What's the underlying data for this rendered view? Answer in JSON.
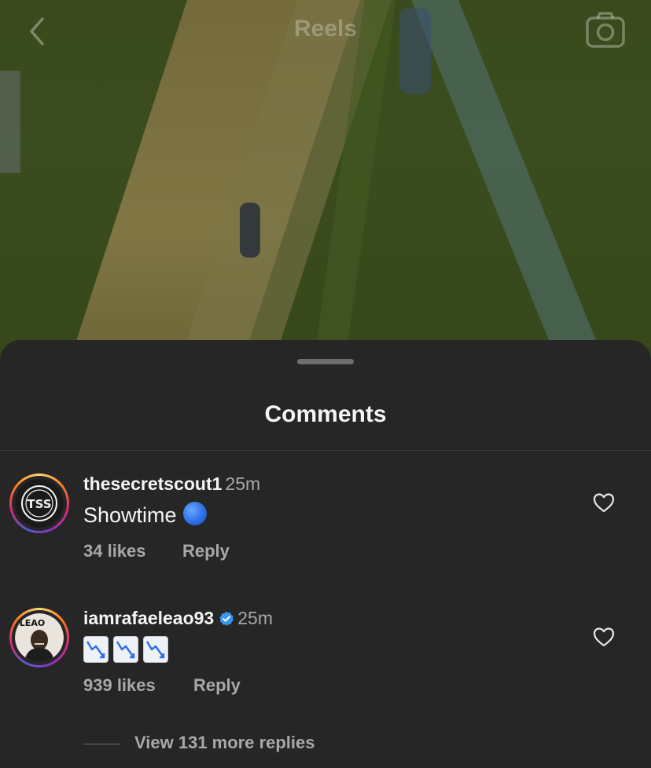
{
  "header": {
    "title": "Reels",
    "back_icon": "chevron-left-icon",
    "camera_icon": "camera-icon"
  },
  "sheet": {
    "title": "Comments"
  },
  "comments": [
    {
      "username": "thesecretscout1",
      "time": "25m",
      "text": "Showtime",
      "emoji": "blue-circle-emoji",
      "likes": "34 likes",
      "reply": "Reply",
      "verified": false
    },
    {
      "username": "iamrafaeleao93",
      "time": "25m",
      "text": "",
      "emoji": "chart-decreasing-emoji x3",
      "likes": "939 likes",
      "reply": "Reply",
      "verified": true,
      "replies_link": "View 131 more replies"
    }
  ],
  "colors": {
    "sheet_bg": "#262626",
    "text_primary": "#f5f5f5",
    "text_secondary": "#a8a8a8",
    "verified_blue": "#3897f0"
  }
}
